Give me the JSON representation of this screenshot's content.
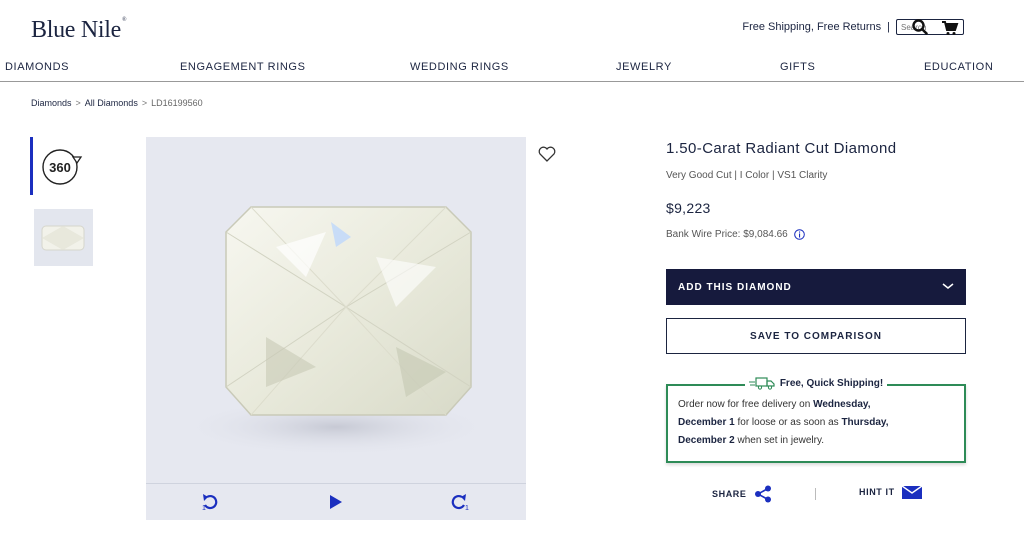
{
  "header": {
    "logo": "Blue Nile",
    "shipping_note": "Free Shipping, Free Returns",
    "divider": "|",
    "search_placeholder": "Search"
  },
  "nav": {
    "items": [
      "DIAMONDS",
      "ENGAGEMENT RINGS",
      "WEDDING RINGS",
      "JEWELRY",
      "GIFTS",
      "EDUCATION"
    ]
  },
  "breadcrumb": {
    "items": [
      "Diamonds",
      "All Diamonds",
      "LD16199560"
    ],
    "separator": ">"
  },
  "gallery": {
    "thumb_360_label": "360",
    "controls": {
      "rotate_left_sub": "1",
      "rotate_right_sub": "1"
    }
  },
  "product": {
    "title": "1.50-Carat Radiant Cut Diamond",
    "specs": "Very Good Cut | I Color | VS1 Clarity",
    "price": "$9,223",
    "wire_price": "Bank Wire Price: $9,084.66"
  },
  "actions": {
    "add_label": "ADD THIS DIAMOND",
    "compare_label": "SAVE TO COMPARISON",
    "share_label": "SHARE",
    "hint_label": "HINT IT"
  },
  "shipping": {
    "heading": "Free, Quick Shipping!",
    "line1_pre": "Order now for free delivery on ",
    "line1_bold": "Wednesday,",
    "line2_bold": "December 1",
    "line2_post": " for loose or as soon as ",
    "line2_bold2": "Thursday,",
    "line3_bold": "December 2",
    "line3_post": " when set in jewelry."
  },
  "colors": {
    "brand_navy": "#161a3d",
    "accent_blue": "#1b2fbf",
    "ship_green": "#2e8b57"
  }
}
